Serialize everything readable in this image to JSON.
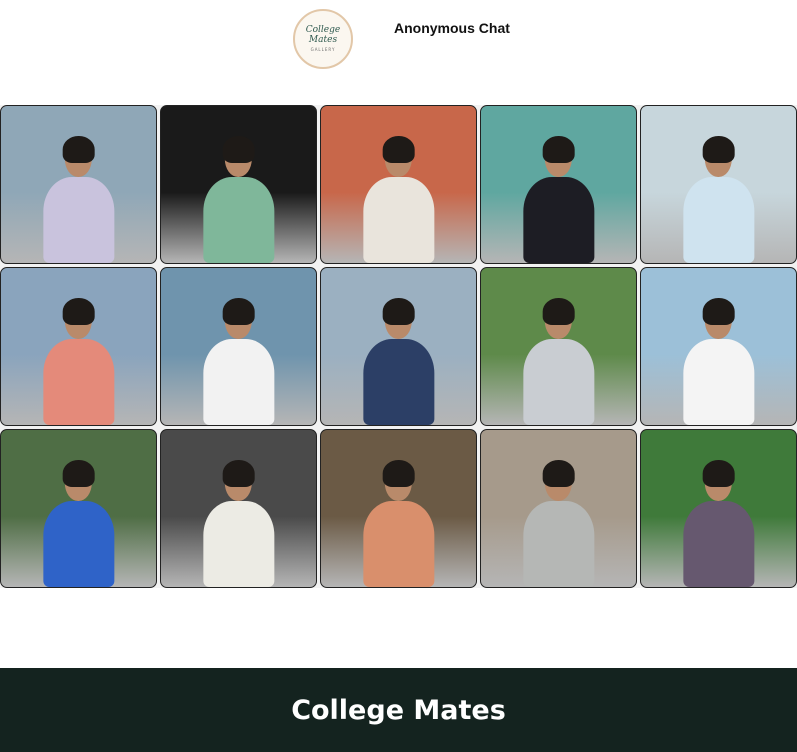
{
  "header": {
    "logo_text": "College Mates",
    "logo_subtext": "GALLERY",
    "nav_link": "Anonymous Chat"
  },
  "gallery": {
    "photos": [
      {
        "bg": "#8fa7b7",
        "body": "#c9c3dd",
        "icon": "photo-person-icon"
      },
      {
        "bg": "#1a1a1a",
        "body": "#7fb79a",
        "icon": "photo-person-icon"
      },
      {
        "bg": "#c8674a",
        "body": "#e9e4dc",
        "icon": "photo-person-icon"
      },
      {
        "bg": "#5fa7a0",
        "body": "#1d1d24",
        "icon": "photo-person-icon"
      },
      {
        "bg": "#c7d6dc",
        "body": "#cfe3ef",
        "icon": "photo-person-icon"
      },
      {
        "bg": "#8aa4bd",
        "body": "#e48a7a",
        "icon": "photo-person-icon"
      },
      {
        "bg": "#6f94ad",
        "body": "#f2f2f2",
        "icon": "photo-person-icon"
      },
      {
        "bg": "#9bb0c1",
        "body": "#2c3f66",
        "icon": "photo-person-icon"
      },
      {
        "bg": "#5e8a4a",
        "body": "#c9cdd2",
        "icon": "photo-person-icon"
      },
      {
        "bg": "#9cc0d8",
        "body": "#f4f4f4",
        "icon": "photo-person-icon"
      },
      {
        "bg": "#4f6e45",
        "body": "#2f63c8",
        "icon": "photo-person-icon"
      },
      {
        "bg": "#4a4a4a",
        "body": "#ecebe4",
        "icon": "photo-person-icon"
      },
      {
        "bg": "#6b5a45",
        "body": "#d98f6c",
        "icon": "photo-person-icon"
      },
      {
        "bg": "#a69a8b",
        "body": "#b5b7b5",
        "icon": "photo-person-icon"
      },
      {
        "bg": "#3f7a3a",
        "body": "#66586f",
        "icon": "photo-person-icon"
      }
    ]
  },
  "footer": {
    "title": "College Mates",
    "background": "#14231f"
  }
}
